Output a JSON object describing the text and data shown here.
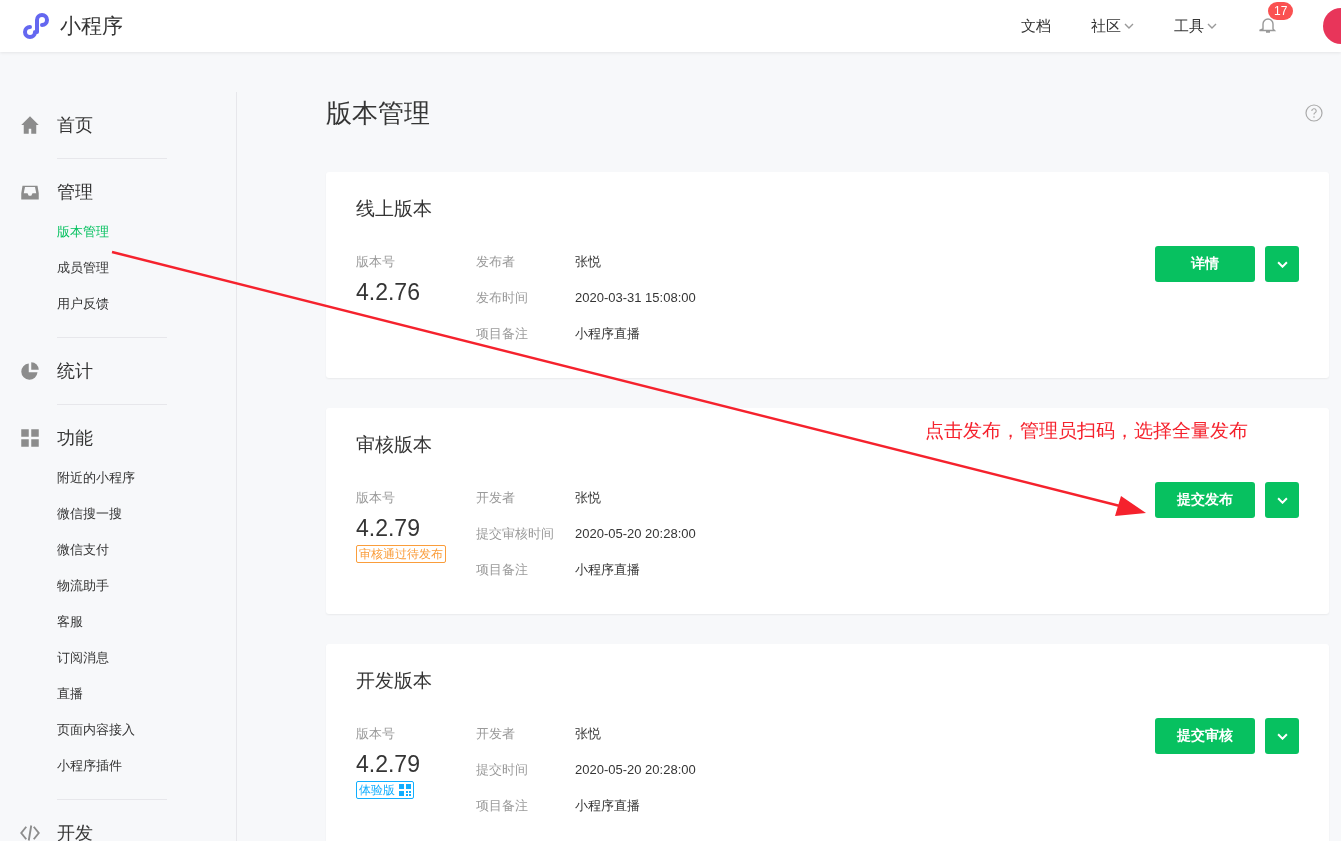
{
  "header": {
    "title": "小程序",
    "nav": [
      {
        "label": "文档",
        "dropdown": false
      },
      {
        "label": "社区",
        "dropdown": true
      },
      {
        "label": "工具",
        "dropdown": true
      }
    ],
    "notification_count": "17"
  },
  "sidebar": {
    "groups": [
      {
        "label": "首页"
      },
      {
        "label": "管理",
        "children": [
          {
            "label": "版本管理",
            "selected": true
          },
          {
            "label": "成员管理",
            "selected": false
          },
          {
            "label": "用户反馈",
            "selected": false
          }
        ]
      },
      {
        "label": "统计"
      },
      {
        "label": "功能",
        "children": [
          {
            "label": "附近的小程序",
            "selected": false
          },
          {
            "label": "微信搜一搜",
            "selected": false
          },
          {
            "label": "微信支付",
            "selected": false
          },
          {
            "label": "物流助手",
            "selected": false
          },
          {
            "label": "客服",
            "selected": false
          },
          {
            "label": "订阅消息",
            "selected": false
          },
          {
            "label": "直播",
            "selected": false
          },
          {
            "label": "页面内容接入",
            "selected": false
          },
          {
            "label": "小程序插件",
            "selected": false
          }
        ]
      },
      {
        "label": "开发"
      }
    ]
  },
  "page_title": "版本管理",
  "cards": [
    {
      "title": "线上版本",
      "version_label": "版本号",
      "version": "4.2.76",
      "fields": [
        {
          "label": "发布者",
          "value": "张悦"
        },
        {
          "label": "发布时间",
          "value": "2020-03-31 15:08:00"
        },
        {
          "label": "项目备注",
          "value": "小程序直播"
        }
      ],
      "button": "详情"
    },
    {
      "title": "审核版本",
      "version_label": "版本号",
      "version": "4.2.79",
      "tag": {
        "kind": "status",
        "label": "审核通过待发布"
      },
      "fields": [
        {
          "label": "开发者",
          "value": "张悦"
        },
        {
          "label": "提交审核时间",
          "value": "2020-05-20 20:28:00"
        },
        {
          "label": "项目备注",
          "value": "小程序直播"
        }
      ],
      "button": "提交发布"
    },
    {
      "title": "开发版本",
      "version_label": "版本号",
      "version": "4.2.79",
      "tag": {
        "kind": "trial",
        "label": "体验版"
      },
      "fields": [
        {
          "label": "开发者",
          "value": "张悦"
        },
        {
          "label": "提交时间",
          "value": "2020-05-20 20:28:00"
        },
        {
          "label": "项目备注",
          "value": "小程序直播"
        }
      ],
      "button": "提交审核"
    }
  ],
  "annotation": {
    "text": "点击发布，管理员扫码，选择全量发布"
  }
}
